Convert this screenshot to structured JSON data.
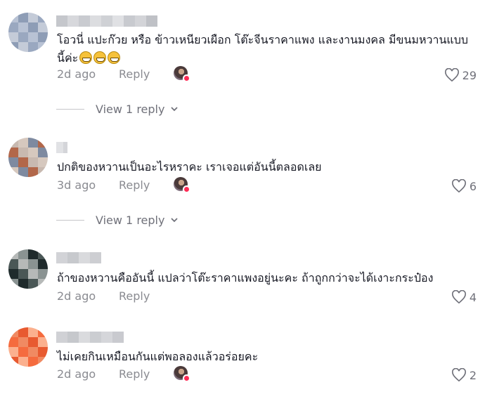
{
  "comments": [
    {
      "text": "โอวนี่ แปะก๊วย หรือ ข้าวเหนียวเผือก โต๊ะจีนราคาแพง และงานมงคล มีขนมหวานแบบนี้ค่ะ",
      "emoji_icons": [
        "grinning-face-icon",
        "grinning-face-icon",
        "grinning-face-icon"
      ],
      "time": "2d ago",
      "reply_label": "Reply",
      "likes": "29",
      "creator_liked": true,
      "view_replies": "View 1 reply",
      "avatar_palette": [
        "#b8c2d4",
        "#9aa8c0",
        "#c4cbd8",
        "#8e9db6"
      ]
    },
    {
      "text": "ปกติของหวานเป็นอะไรหราคะ เราเจอแต่อันนี้ตลอดเลย",
      "time": "3d ago",
      "reply_label": "Reply",
      "likes": "6",
      "creator_liked": true,
      "view_replies": "View 1 reply",
      "avatar_palette": [
        "#c8b9b0",
        "#b2674a",
        "#7e8aa0",
        "#d6c8be"
      ]
    },
    {
      "text": "ถ้าของหวานคืออันนี้ แปลว่าโต๊ะราคาแพงอยู่นะคะ ถ้าถูกกว่าจะได้เงาะกระป๋อง",
      "time": "2d ago",
      "reply_label": "Reply",
      "likes": "4",
      "creator_liked": false,
      "avatar_palette": [
        "#b6b9b8",
        "#4a5756",
        "#1f2b2c",
        "#8a9392"
      ]
    },
    {
      "text": "ไม่เคยกินเหมือนกันแต่พอลองแล้วอร่อยคะ",
      "time": "2d ago",
      "reply_label": "Reply",
      "likes": "2",
      "creator_liked": true,
      "avatar_palette": [
        "#f08a62",
        "#f56b3e",
        "#fbb08e",
        "#e85a30"
      ]
    }
  ],
  "icons": {
    "like": "heart-outline-icon",
    "chevron": "chevron-down-icon",
    "creator": "creator-avatar-icon"
  }
}
